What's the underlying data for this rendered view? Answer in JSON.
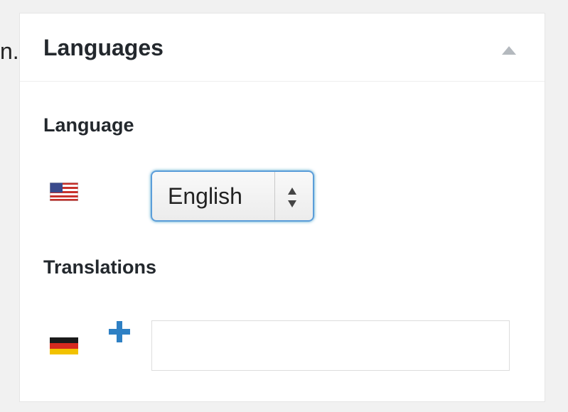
{
  "edge_text": "n.",
  "panel": {
    "title": "Languages",
    "toggle_icon": "triangle-up"
  },
  "language_section": {
    "label": "Language",
    "flag": "us-flag",
    "select_value": "English"
  },
  "translations_section": {
    "label": "Translations",
    "flag": "de-flag",
    "add_icon": "plus",
    "input_value": "",
    "input_placeholder": ""
  },
  "colors": {
    "accent": "#2e80c4",
    "focus_border": "#5b9dd9",
    "text": "#23282d"
  }
}
